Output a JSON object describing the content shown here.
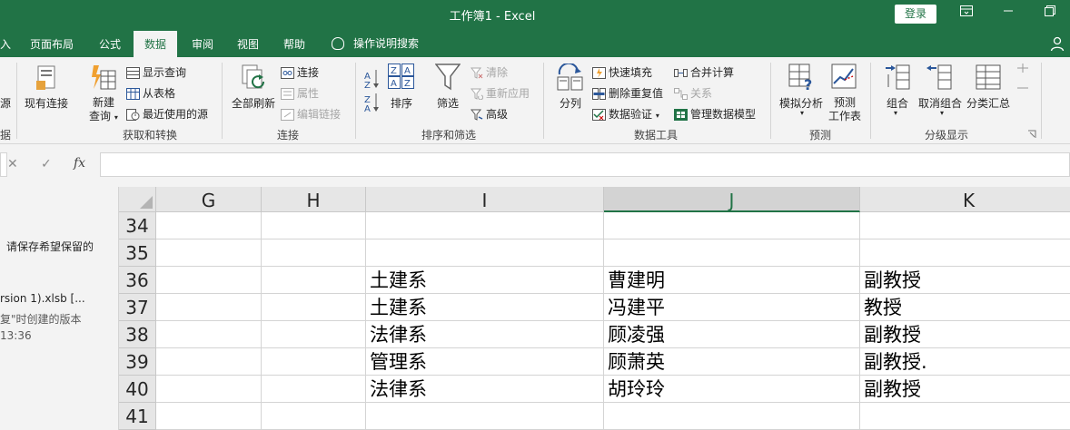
{
  "window": {
    "title": "工作簿1  -  Excel",
    "login_label": "登录",
    "controls": [
      "ribbon-display-icon",
      "minimize-icon",
      "restore-icon"
    ]
  },
  "tabs": {
    "items": [
      "入",
      "页面布局",
      "公式",
      "数据",
      "审阅",
      "视图",
      "帮助"
    ],
    "active": "数据",
    "tell_me": "操作说明搜索"
  },
  "ribbon": {
    "get_data": {
      "partial_label": "源",
      "existing_connections": "现有连接",
      "new_query_line1": "新建",
      "new_query_line2": "查询",
      "show_queries": "显示查询",
      "from_table": "从表格",
      "recent_sources": "最近使用的源",
      "group_label": "获取和转换",
      "partial_group_label": "据"
    },
    "connections": {
      "refresh_all": "全部刷新",
      "connections": "连接",
      "properties": "属性",
      "edit_links": "编辑链接",
      "group_label": "连接"
    },
    "sort_filter": {
      "sort": "排序",
      "filter": "筛选",
      "clear": "清除",
      "reapply": "重新应用",
      "advanced": "高级",
      "group_label": "排序和筛选"
    },
    "data_tools": {
      "text_to_columns": "分列",
      "flash_fill": "快速填充",
      "remove_duplicates": "删除重复值",
      "data_validation": "数据验证",
      "consolidate": "合并计算",
      "relationships": "关系",
      "manage_data_model": "管理数据模型",
      "group_label": "数据工具"
    },
    "forecast": {
      "what_if": "模拟分析",
      "forecast_sheet_line1": "预测",
      "forecast_sheet_line2": "工作表",
      "group_label": "预测"
    },
    "outline": {
      "group": "组合",
      "ungroup": "取消组合",
      "subtotal": "分类汇总",
      "group_label": "分级显示"
    }
  },
  "formula_bar": {
    "cancel": "✕",
    "enter": "✓",
    "fx": "fx",
    "value": ""
  },
  "recovery_pane": {
    "line1": "请保存希望保留的",
    "file_name": "rsion 1).xlsb  [...",
    "file_desc": "复\"时创建的版本",
    "file_time": "13:36"
  },
  "sheet": {
    "columns": [
      "G",
      "H",
      "I",
      "J",
      "K"
    ],
    "selected_column": "J",
    "rows": [
      {
        "num": "34",
        "cells": [
          "",
          "",
          "",
          "",
          ""
        ]
      },
      {
        "num": "35",
        "cells": [
          "",
          "",
          "",
          "",
          ""
        ]
      },
      {
        "num": "36",
        "cells": [
          "",
          "",
          "土建系",
          "曹建明",
          "副教授"
        ]
      },
      {
        "num": "37",
        "cells": [
          "",
          "",
          "土建系",
          "冯建平",
          "教授"
        ]
      },
      {
        "num": "38",
        "cells": [
          "",
          "",
          "法律系",
          "顾凌强",
          "副教授"
        ]
      },
      {
        "num": "39",
        "cells": [
          "",
          "",
          "管理系",
          "顾萧英",
          "副教授."
        ]
      },
      {
        "num": "40",
        "cells": [
          "",
          "",
          "法律系",
          "胡玲玲",
          "副教授"
        ]
      },
      {
        "num": "41",
        "cells": [
          "",
          "",
          "",
          "",
          ""
        ]
      }
    ]
  },
  "colors": {
    "excel_green": "#217346",
    "ribbon_bg": "#f3f3f3"
  }
}
